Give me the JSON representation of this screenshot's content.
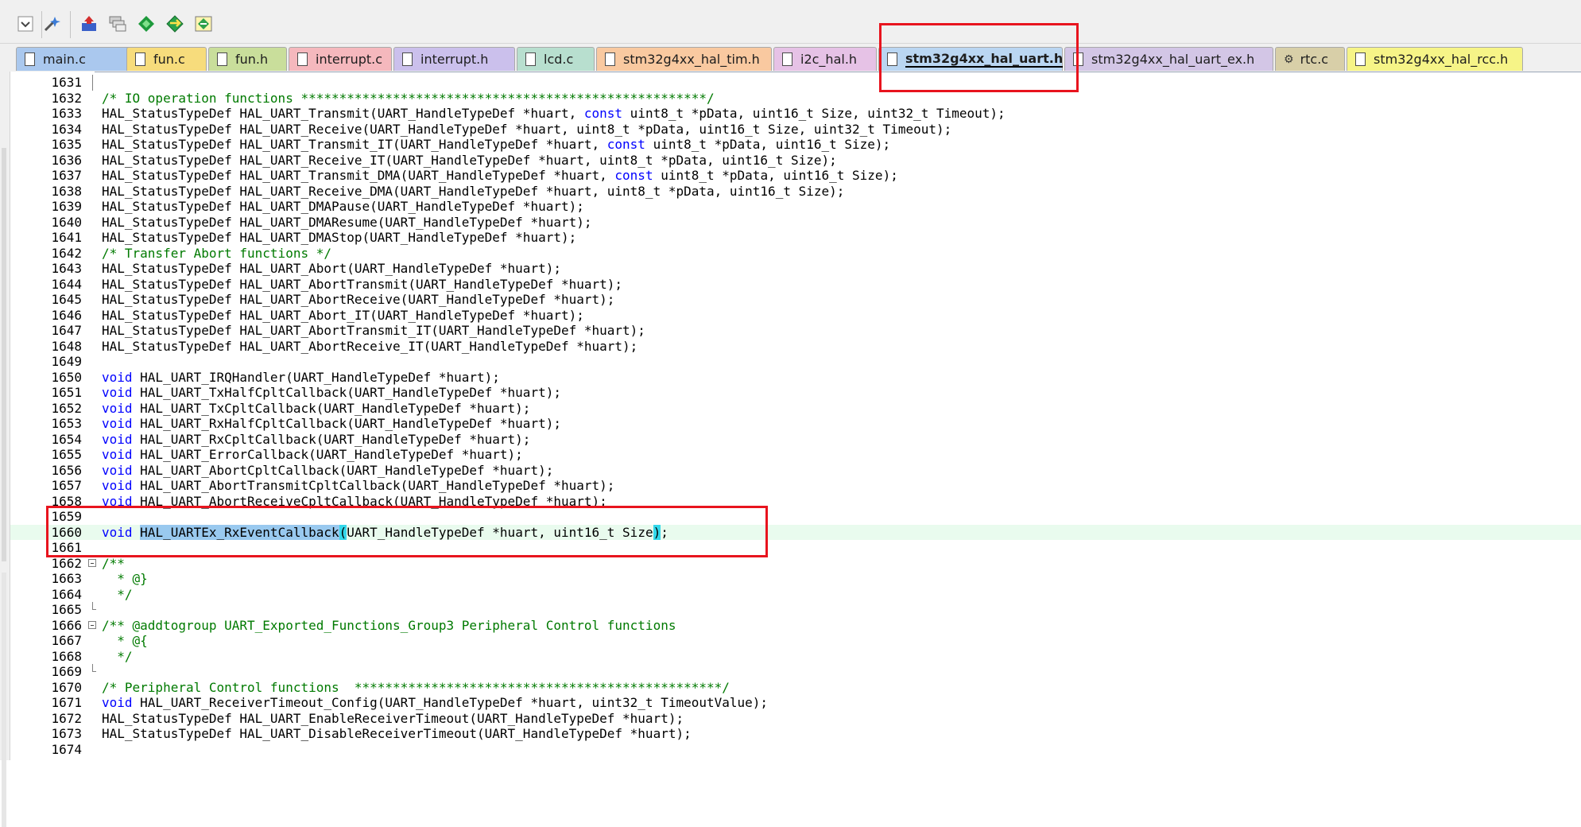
{
  "tabs": [
    {
      "label": "main.c",
      "icon": "document-icon",
      "color": "#aac8ee"
    },
    {
      "label": "fun.c",
      "icon": "document-icon",
      "color": "#f7dc7c"
    },
    {
      "label": "fun.h",
      "icon": "document-icon",
      "color": "#c9de9b"
    },
    {
      "label": "interrupt.c",
      "icon": "document-icon",
      "color": "#f5b8bd"
    },
    {
      "label": "interrupt.h",
      "icon": "document-icon",
      "color": "#cbc0ec"
    },
    {
      "label": "lcd.c",
      "icon": "document-icon",
      "color": "#b8dfcf"
    },
    {
      "label": "stm32g4xx_hal_tim.h",
      "icon": "document-icon",
      "color": "#f9c9a0"
    },
    {
      "label": "i2c_hal.h",
      "icon": "document-icon",
      "color": "#e6c2e6"
    },
    {
      "label": "stm32g4xx_hal_uart.h",
      "icon": "document-icon",
      "color": "#bad6f2",
      "active": true
    },
    {
      "label": "stm32g4xx_hal_uart_ex.h",
      "icon": "document-icon",
      "color": "#d3c6e6"
    },
    {
      "label": "rtc.c",
      "icon": "gear-document-icon",
      "color": "#d8cfa8"
    },
    {
      "label": "stm32g4xx_hal_rcc.h",
      "icon": "document-icon",
      "color": "#f6f487"
    }
  ],
  "toolbar_icons": [
    "chevron-down-icon",
    "wand-icon",
    "load-icon",
    "stack-icon",
    "diamond-icon",
    "diamond-arrow-icon",
    "gem-icon"
  ],
  "colors": {
    "keyword": "#0000ff",
    "comment": "#007a00",
    "highlight_box": "#e8141e",
    "current_line": "#e9fbee",
    "selection": "#99c9ef"
  },
  "editor": {
    "lines": [
      {
        "n": "1631",
        "fold": "v",
        "parts": []
      },
      {
        "n": "1632",
        "fold": "",
        "parts": [
          {
            "t": "/* IO operation functions *****************************************************/",
            "c": "cm"
          }
        ]
      },
      {
        "n": "1633",
        "fold": "",
        "parts": [
          {
            "t": "HAL_StatusTypeDef HAL_UART_Transmit(UART_HandleTypeDef *huart, "
          },
          {
            "t": "const",
            "c": "kw"
          },
          {
            "t": " uint8_t *pData, uint16_t Size, uint32_t Timeout);"
          }
        ]
      },
      {
        "n": "1634",
        "fold": "",
        "parts": [
          {
            "t": "HAL_StatusTypeDef HAL_UART_Receive(UART_HandleTypeDef *huart, uint8_t *pData, uint16_t Size, uint32_t Timeout);"
          }
        ]
      },
      {
        "n": "1635",
        "fold": "",
        "parts": [
          {
            "t": "HAL_StatusTypeDef HAL_UART_Transmit_IT(UART_HandleTypeDef *huart, "
          },
          {
            "t": "const",
            "c": "kw"
          },
          {
            "t": " uint8_t *pData, uint16_t Size);"
          }
        ]
      },
      {
        "n": "1636",
        "fold": "",
        "parts": [
          {
            "t": "HAL_StatusTypeDef HAL_UART_Receive_IT(UART_HandleTypeDef *huart, uint8_t *pData, uint16_t Size);"
          }
        ]
      },
      {
        "n": "1637",
        "fold": "",
        "parts": [
          {
            "t": "HAL_StatusTypeDef HAL_UART_Transmit_DMA(UART_HandleTypeDef *huart, "
          },
          {
            "t": "const",
            "c": "kw"
          },
          {
            "t": " uint8_t *pData, uint16_t Size);"
          }
        ]
      },
      {
        "n": "1638",
        "fold": "",
        "parts": [
          {
            "t": "HAL_StatusTypeDef HAL_UART_Receive_DMA(UART_HandleTypeDef *huart, uint8_t *pData, uint16_t Size);"
          }
        ]
      },
      {
        "n": "1639",
        "fold": "",
        "parts": [
          {
            "t": "HAL_StatusTypeDef HAL_UART_DMAPause(UART_HandleTypeDef *huart);"
          }
        ]
      },
      {
        "n": "1640",
        "fold": "",
        "parts": [
          {
            "t": "HAL_StatusTypeDef HAL_UART_DMAResume(UART_HandleTypeDef *huart);"
          }
        ]
      },
      {
        "n": "1641",
        "fold": "",
        "parts": [
          {
            "t": "HAL_StatusTypeDef HAL_UART_DMAStop(UART_HandleTypeDef *huart);"
          }
        ]
      },
      {
        "n": "1642",
        "fold": "",
        "parts": [
          {
            "t": "/* Transfer Abort functions */",
            "c": "cm"
          }
        ]
      },
      {
        "n": "1643",
        "fold": "",
        "parts": [
          {
            "t": "HAL_StatusTypeDef HAL_UART_Abort(UART_HandleTypeDef *huart);"
          }
        ]
      },
      {
        "n": "1644",
        "fold": "",
        "parts": [
          {
            "t": "HAL_StatusTypeDef HAL_UART_AbortTransmit(UART_HandleTypeDef *huart);"
          }
        ]
      },
      {
        "n": "1645",
        "fold": "",
        "parts": [
          {
            "t": "HAL_StatusTypeDef HAL_UART_AbortReceive(UART_HandleTypeDef *huart);"
          }
        ]
      },
      {
        "n": "1646",
        "fold": "",
        "parts": [
          {
            "t": "HAL_StatusTypeDef HAL_UART_Abort_IT(UART_HandleTypeDef *huart);"
          }
        ]
      },
      {
        "n": "1647",
        "fold": "",
        "parts": [
          {
            "t": "HAL_StatusTypeDef HAL_UART_AbortTransmit_IT(UART_HandleTypeDef *huart);"
          }
        ]
      },
      {
        "n": "1648",
        "fold": "",
        "parts": [
          {
            "t": "HAL_StatusTypeDef HAL_UART_AbortReceive_IT(UART_HandleTypeDef *huart);"
          }
        ]
      },
      {
        "n": "1649",
        "fold": "",
        "parts": []
      },
      {
        "n": "1650",
        "fold": "",
        "parts": [
          {
            "t": "void",
            "c": "kw"
          },
          {
            "t": " HAL_UART_IRQHandler(UART_HandleTypeDef *huart);"
          }
        ]
      },
      {
        "n": "1651",
        "fold": "",
        "parts": [
          {
            "t": "void",
            "c": "kw"
          },
          {
            "t": " HAL_UART_TxHalfCpltCallback(UART_HandleTypeDef *huart);"
          }
        ]
      },
      {
        "n": "1652",
        "fold": "",
        "parts": [
          {
            "t": "void",
            "c": "kw"
          },
          {
            "t": " HAL_UART_TxCpltCallback(UART_HandleTypeDef *huart);"
          }
        ]
      },
      {
        "n": "1653",
        "fold": "",
        "parts": [
          {
            "t": "void",
            "c": "kw"
          },
          {
            "t": " HAL_UART_RxHalfCpltCallback(UART_HandleTypeDef *huart);"
          }
        ]
      },
      {
        "n": "1654",
        "fold": "",
        "parts": [
          {
            "t": "void",
            "c": "kw"
          },
          {
            "t": " HAL_UART_RxCpltCallback(UART_HandleTypeDef *huart);"
          }
        ]
      },
      {
        "n": "1655",
        "fold": "",
        "parts": [
          {
            "t": "void",
            "c": "kw"
          },
          {
            "t": " HAL_UART_ErrorCallback(UART_HandleTypeDef *huart);"
          }
        ]
      },
      {
        "n": "1656",
        "fold": "",
        "parts": [
          {
            "t": "void",
            "c": "kw"
          },
          {
            "t": " HAL_UART_AbortCpltCallback(UART_HandleTypeDef *huart);"
          }
        ]
      },
      {
        "n": "1657",
        "fold": "",
        "parts": [
          {
            "t": "void",
            "c": "kw"
          },
          {
            "t": " HAL_UART_AbortTransmitCpltCallback(UART_HandleTypeDef *huart);"
          }
        ]
      },
      {
        "n": "1658",
        "fold": "",
        "parts": [
          {
            "t": "void",
            "c": "kw"
          },
          {
            "t": " HAL_UART_AbortReceiveCpltCallback(UART_HandleTypeDef *huart);"
          }
        ]
      },
      {
        "n": "1659",
        "fold": "",
        "parts": []
      },
      {
        "n": "1660",
        "fold": "",
        "hl": true,
        "parts": [
          {
            "t": "void",
            "c": "kw"
          },
          {
            "t": " "
          },
          {
            "t": "HAL_UARTEx_RxEventCallback",
            "c": "selfn"
          },
          {
            "t": "(",
            "c": "brk"
          },
          {
            "t": "UART_HandleTypeDef *huart, uint16_t Size"
          },
          {
            "t": ")",
            "c": "brk"
          },
          {
            "t": ";"
          }
        ]
      },
      {
        "n": "1661",
        "fold": "",
        "parts": []
      },
      {
        "n": "1662",
        "fold": "box",
        "parts": [
          {
            "t": "/**",
            "c": "cm"
          }
        ]
      },
      {
        "n": "1663",
        "fold": "",
        "parts": [
          {
            "t": "  * @}",
            "c": "cm"
          }
        ]
      },
      {
        "n": "1664",
        "fold": "",
        "parts": [
          {
            "t": "  */",
            "c": "cm"
          }
        ]
      },
      {
        "n": "1665",
        "fold": "end",
        "parts": []
      },
      {
        "n": "1666",
        "fold": "box",
        "parts": [
          {
            "t": "/** @addtogroup UART_Exported_Functions_Group3 Peripheral Control functions",
            "c": "cm"
          }
        ]
      },
      {
        "n": "1667",
        "fold": "",
        "parts": [
          {
            "t": "  * @{",
            "c": "cm"
          }
        ]
      },
      {
        "n": "1668",
        "fold": "",
        "parts": [
          {
            "t": "  */",
            "c": "cm"
          }
        ]
      },
      {
        "n": "1669",
        "fold": "end",
        "parts": []
      },
      {
        "n": "1670",
        "fold": "",
        "parts": [
          {
            "t": "/* Peripheral Control functions  ************************************************/",
            "c": "cm"
          }
        ]
      },
      {
        "n": "1671",
        "fold": "",
        "parts": [
          {
            "t": "void",
            "c": "kw"
          },
          {
            "t": " HAL_UART_ReceiverTimeout_Config(UART_HandleTypeDef *huart, uint32_t TimeoutValue);"
          }
        ]
      },
      {
        "n": "1672",
        "fold": "",
        "parts": [
          {
            "t": "HAL_StatusTypeDef HAL_UART_EnableReceiverTimeout(UART_HandleTypeDef *huart);"
          }
        ]
      },
      {
        "n": "1673",
        "fold": "",
        "parts": [
          {
            "t": "HAL_StatusTypeDef HAL_UART_DisableReceiverTimeout(UART_HandleTypeDef *huart);"
          }
        ]
      },
      {
        "n": "1674",
        "fold": "",
        "parts": []
      }
    ]
  }
}
